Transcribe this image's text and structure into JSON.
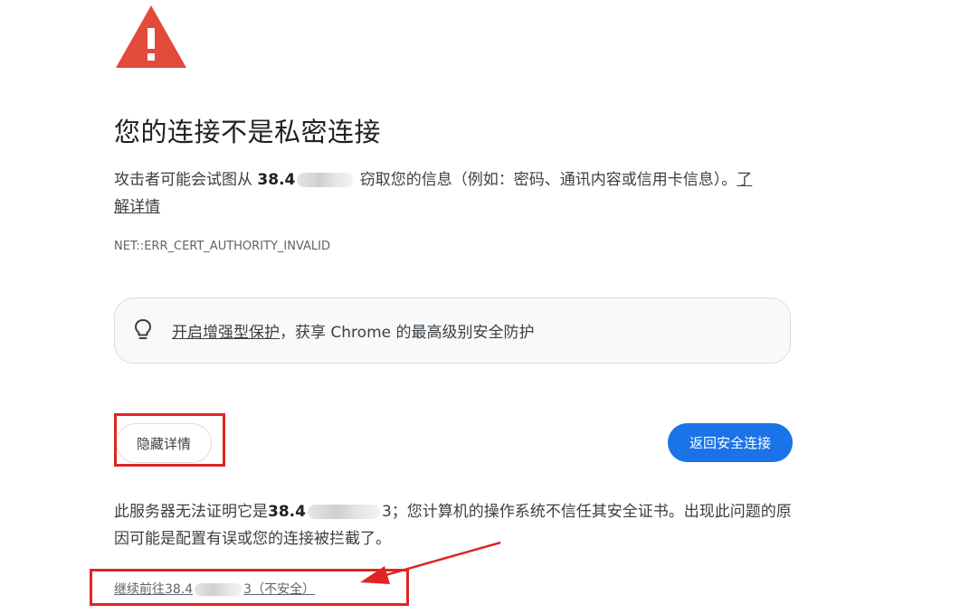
{
  "page": {
    "title": "您的连接不是私密连接"
  },
  "explanation": {
    "before": "攻击者可能会试图从 ",
    "host": "38.4",
    "after": " 窃取您的信息（例如：密码、通讯内容或信用卡信息）。",
    "learn_more": "了解详情"
  },
  "error_code": "NET::ERR_CERT_AUTHORITY_INVALID",
  "enhanced_protection": {
    "link": "开启增强型保护",
    "rest": "，获享 Chrome 的最高级别安全防护"
  },
  "buttons": {
    "hide_details": "隐藏详情",
    "back_to_safety": "返回安全连接"
  },
  "details": {
    "before": "此服务器无法证明它是",
    "host": "38.4",
    "host_tail": "3",
    "after": "；您计算机的操作系统不信任其安全证书。出现此问题的原因可能是配置有误或您的连接被拦截了。"
  },
  "proceed": {
    "before": "继续前往38.4",
    "tail": "3",
    "after": "（不安全）"
  },
  "colors": {
    "warning_red": "#e24a3b",
    "primary_blue": "#1a73e8",
    "annotation_red": "#e02424"
  }
}
